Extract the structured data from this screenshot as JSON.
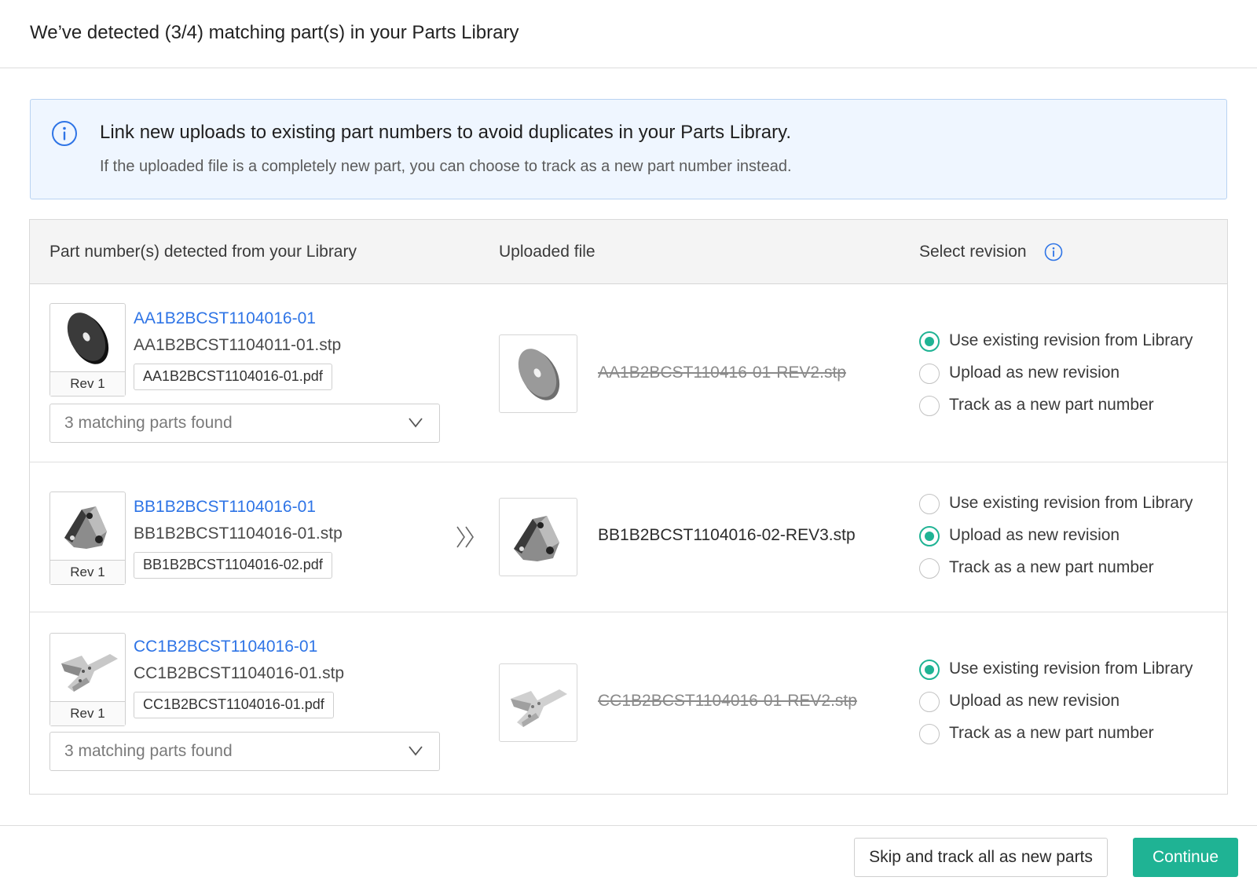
{
  "header": {
    "title": "We’ve detected (3/4) matching part(s) in your Parts Library"
  },
  "banner": {
    "heading": "Link new uploads to existing part numbers to avoid duplicates in your Parts Library.",
    "subtext": "If the uploaded file is a completely new part, you can choose to track as a new part number instead.",
    "icon": "info-icon"
  },
  "table": {
    "headers": {
      "library": "Part number(s) detected from your Library",
      "uploaded": "Uploaded file",
      "revision": "Select revision"
    },
    "rows": [
      {
        "part_number": "AA1B2BCST1104016-01",
        "file": "AA1B2BCST1104011-01.stp",
        "pdf": "AA1B2BCST1104016-01.pdf",
        "rev": "Rev 1",
        "dropdown": "3 matching parts found",
        "uploaded_file": "AA1B2BCST110416-01-REV2.stp",
        "options": [
          "Use existing revision from Library",
          "Upload as new revision",
          "Track as a new part number"
        ],
        "selected": 0
      },
      {
        "part_number": "BB1B2BCST1104016-01",
        "file": "BB1B2BCST1104016-01.stp",
        "pdf": "BB1B2BCST1104016-02.pdf",
        "rev": "Rev 1",
        "uploaded_file": "BB1B2BCST1104016-02-REV3.stp",
        "options": [
          "Use existing revision from Library",
          "Upload as new revision",
          "Track as a new part number"
        ],
        "selected": 1
      },
      {
        "part_number": "CC1B2BCST1104016-01",
        "file": "CC1B2BCST1104016-01.stp",
        "pdf": "CC1B2BCST1104016-01.pdf",
        "rev": "Rev 1",
        "dropdown": "3 matching parts found",
        "uploaded_file": "CC1B2BCST1104016-01-REV2.stp",
        "options": [
          "Use existing revision from Library",
          "Upload as new revision",
          "Track as a new part number"
        ],
        "selected": 0
      }
    ]
  },
  "footer": {
    "skip_label": "Skip and track all as new parts",
    "continue_label": "Continue"
  },
  "colors": {
    "link": "#2e74e6",
    "accent": "#1fb394",
    "banner_bg": "#eff6ff",
    "banner_border": "#b9d3f2"
  }
}
